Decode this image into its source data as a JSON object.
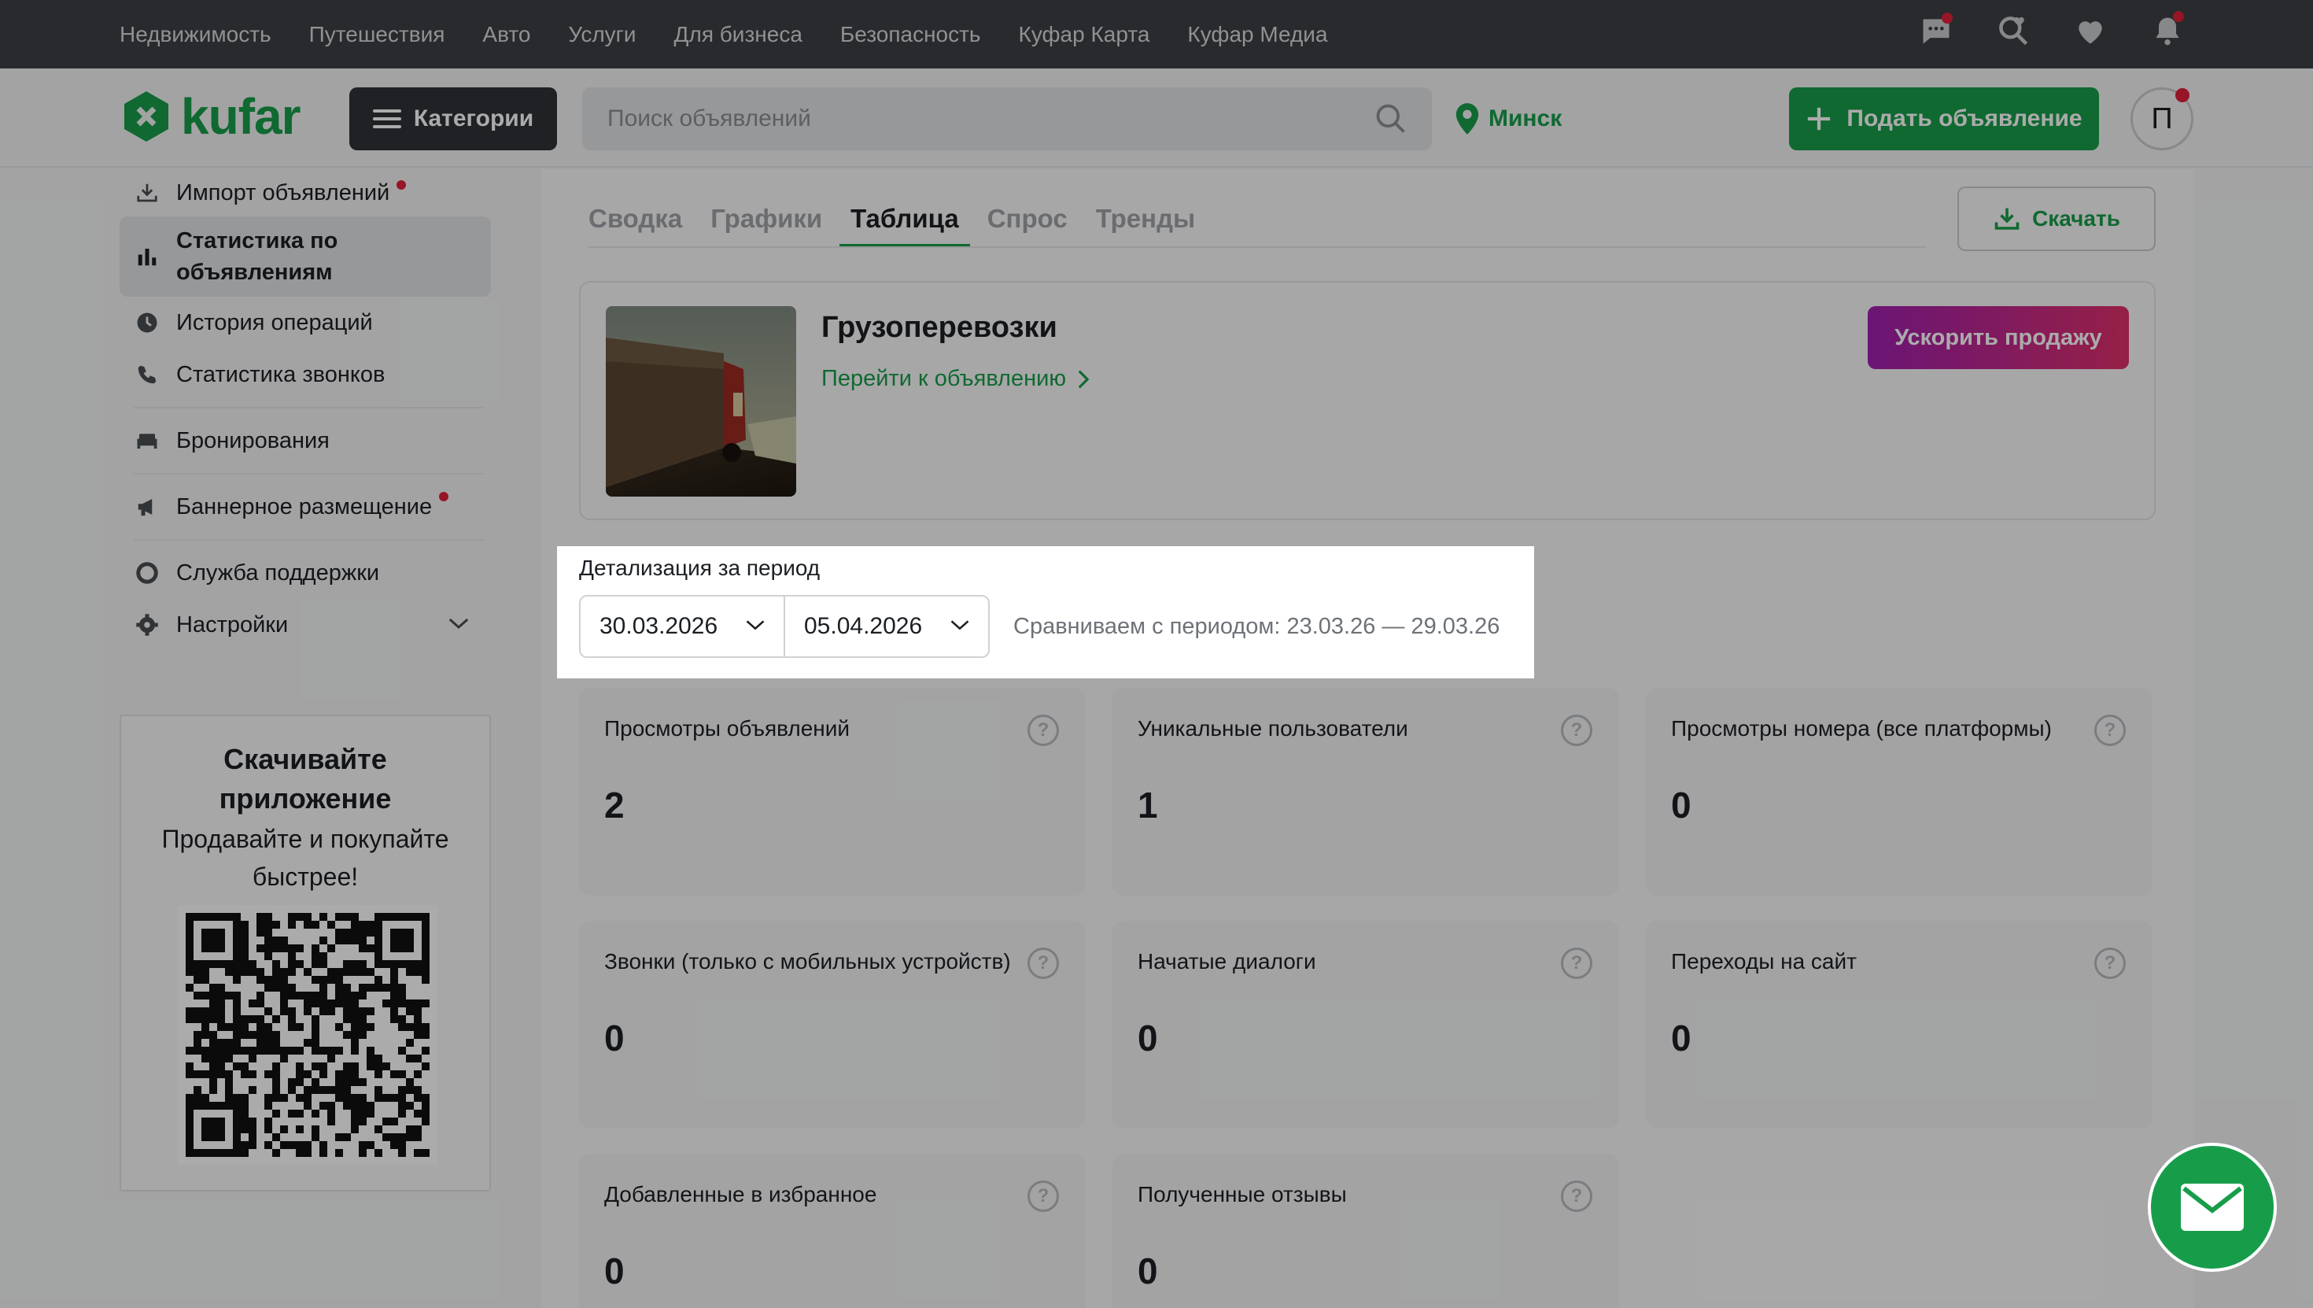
{
  "topnav": [
    "Недвижимость",
    "Путешествия",
    "Авто",
    "Услуги",
    "Для бизнеса",
    "Безопасность",
    "Куфар Карта",
    "Куфар Медиа"
  ],
  "topicons": [
    "messages-icon",
    "saved-search-icon",
    "favorites-icon",
    "notifications-icon"
  ],
  "header": {
    "logo": "kufar",
    "categories_label": "Категории",
    "search_placeholder": "Поиск объявлений",
    "city": "Минск",
    "post_label": "Подать объявление",
    "avatar_letter": "П"
  },
  "sidebar": {
    "items": [
      {
        "label": "Импорт объявлений",
        "icon": "import-icon",
        "dot": true
      },
      {
        "label": "Статистика по объявлениям",
        "icon": "bar-chart-icon",
        "active": true
      },
      {
        "label": "История операций",
        "icon": "clock-icon"
      },
      {
        "label": "Статистика звонков",
        "icon": "phone-icon"
      },
      {
        "label": "Бронирования",
        "icon": "bed-icon"
      },
      {
        "label": "Баннерное размещение",
        "icon": "megaphone-icon",
        "dot": true
      },
      {
        "label": "Служба поддержки",
        "icon": "lifebuoy-icon"
      },
      {
        "label": "Настройки",
        "icon": "gear-icon"
      }
    ],
    "promo": {
      "title": "Скачивайте приложение",
      "text": "Продавайте и покупайте быстрее!"
    }
  },
  "tabs": [
    {
      "label": "Сводка"
    },
    {
      "label": "Графики"
    },
    {
      "label": "Таблица",
      "active": true
    },
    {
      "label": "Спрос"
    },
    {
      "label": "Тренды"
    }
  ],
  "download_label": "Скачать",
  "ad": {
    "title": "Грузоперевозки",
    "link": "Перейти к объявлению",
    "boost_label": "Ускорить продажу"
  },
  "period": {
    "label": "Детализация за период",
    "from": "30.03.2026",
    "to": "05.04.2026",
    "compare": "Сравниваем с периодом: 23.03.26 — 29.03.26"
  },
  "stats": [
    {
      "label": "Просмотры объявлений",
      "value": "2"
    },
    {
      "label": "Уникальные пользователи",
      "value": "1"
    },
    {
      "label": "Просмотры номера (все платформы)",
      "value": "0"
    },
    {
      "label": "Звонки (только с мобильных устройств)",
      "value": "0"
    },
    {
      "label": "Начатые диалоги",
      "value": "0"
    },
    {
      "label": "Переходы на сайт",
      "value": "0"
    },
    {
      "label": "Добавленные в избранное",
      "value": "0"
    },
    {
      "label": "Полученные отзывы",
      "value": "0"
    }
  ],
  "help_glyph": "?",
  "colors": {
    "brand": "#179d4a",
    "topbar": "#3d3f43",
    "boost_from": "#a020b0",
    "boost_to": "#e0306a",
    "alert": "#e0203a"
  }
}
